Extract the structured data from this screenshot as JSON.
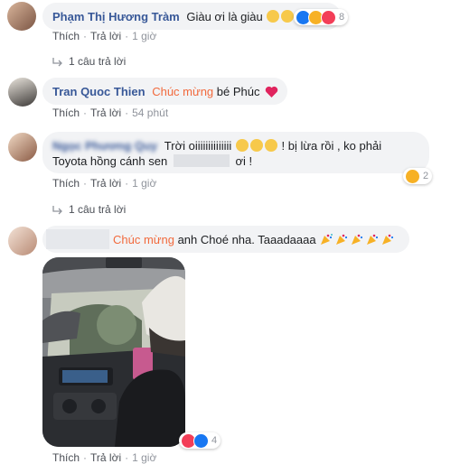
{
  "comments": [
    {
      "author": "Phạm Thị Hương Tràm",
      "text": "Giàu ơi là giàu",
      "emoji": [
        "grin-emoji",
        "grin-emoji"
      ],
      "reactions": {
        "icons": [
          "like-reaction",
          "haha-reaction",
          "love-reaction"
        ],
        "count": "8"
      },
      "actions": {
        "like": "Thích",
        "reply": "Trả lời",
        "time": "1 giờ"
      },
      "replies_label": "1 câu trả lời"
    },
    {
      "author": "Tran Quoc Thien",
      "mention": "Chúc mừng",
      "text": "bé Phúc",
      "actions": {
        "like": "Thích",
        "reply": "Trả lời",
        "time": "54 phút"
      }
    },
    {
      "author": "Ngọc Phương Quy",
      "line1_a": "Trời oiiiiiiiiiiiiii",
      "line1_b": "! bị lừa rồi , ko phải",
      "line2_a": "Toyota hồng cánh sen",
      "line2_b": "ơi !",
      "reactions": {
        "icons": [
          "haha-reaction"
        ],
        "count": "2"
      },
      "actions": {
        "like": "Thích",
        "reply": "Trả lời",
        "time": "1 giờ"
      },
      "replies_label": "1 câu trả lời"
    },
    {
      "mention": "Chúc mừng",
      "text": "anh Choé nha. Taaadaaaa",
      "reactions": {
        "icons": [
          "love-reaction",
          "like-reaction"
        ],
        "count": "4"
      },
      "actions": {
        "like": "Thích",
        "reply": "Trả lời",
        "time": "1 giờ"
      }
    }
  ],
  "colors": {
    "name": "#385898",
    "mention": "#f26a3d",
    "bubble": "#f2f3f5",
    "meta": "#90949c",
    "heart": "#e0245e",
    "like": "#1877f2",
    "haha": "#f7b125",
    "love": "#f33e58"
  }
}
